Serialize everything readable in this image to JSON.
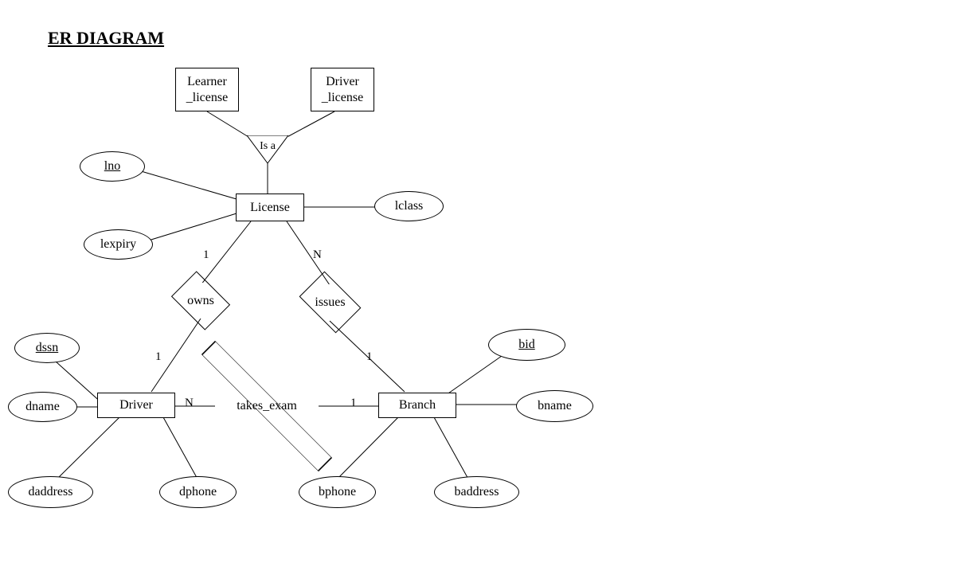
{
  "title": "ER DIAGRAM",
  "entities": {
    "learner_license": "Learner\n_license",
    "driver_license": "Driver\n_license",
    "license": "License",
    "driver": "Driver",
    "branch": "Branch"
  },
  "isa": "Is a",
  "relationships": {
    "owns": "owns",
    "issues": "issues",
    "takes_exam": "takes_exam"
  },
  "attributes": {
    "lno": "lno",
    "lexpiry": "lexpiry",
    "lclass": "lclass",
    "dssn": "dssn",
    "dname": "dname",
    "daddress": "daddress",
    "dphone": "dphone",
    "bid": "bid",
    "bname": "bname",
    "baddress": "baddress",
    "bphone": "bphone"
  },
  "cardinalities": {
    "owns_top": "1",
    "owns_bottom": "1",
    "issues_top": "N",
    "issues_bottom": "1",
    "takes_left": "N",
    "takes_right": "1"
  }
}
